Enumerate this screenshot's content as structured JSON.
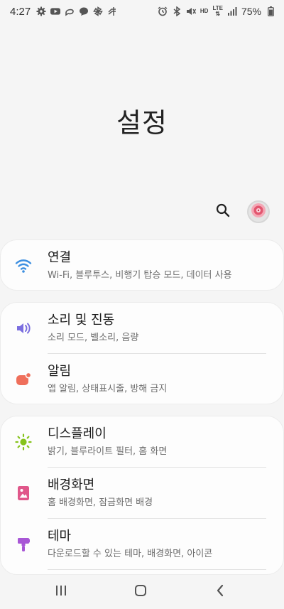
{
  "status_bar": {
    "time": "4:27",
    "battery": "75%",
    "hd": "HD",
    "lte": "LTE",
    "left_icons": [
      "settings-gear-icon",
      "youtube-icon",
      "messenger-icon",
      "chat-bubble-icon",
      "pinwheel-icon",
      "mute-bird-icon"
    ],
    "right_icons": [
      "alarm-icon",
      "bluetooth-icon",
      "mute-icon",
      "hd-lte-icon",
      "signal-icon",
      "battery-icon"
    ]
  },
  "header": {
    "title": "설정"
  },
  "groups": [
    {
      "items": [
        {
          "title": "연결",
          "subtitle": "Wi-Fi, 블루투스, 비행기 탑승 모드, 데이터 사용",
          "icon": "wifi-icon",
          "icon_color": "#3d8fe0"
        }
      ]
    },
    {
      "items": [
        {
          "title": "소리 및 진동",
          "subtitle": "소리 모드, 벨소리, 음량",
          "icon": "speaker-icon",
          "icon_color": "#7b6ee0"
        },
        {
          "title": "알림",
          "subtitle": "앱 알림, 상태표시줄, 방해 금지",
          "icon": "notification-icon",
          "icon_color": "#ef6f5b"
        }
      ]
    },
    {
      "items": [
        {
          "title": "디스플레이",
          "subtitle": "밝기, 블루라이트 필터, 홈 화면",
          "icon": "brightness-icon",
          "icon_color": "#86c31c"
        },
        {
          "title": "배경화면",
          "subtitle": "홈 배경화면, 잠금화면 배경",
          "icon": "wallpaper-icon",
          "icon_color": "#e0578a"
        },
        {
          "title": "테마",
          "subtitle": "다운로드할 수 있는 테마, 배경화면, 아이콘",
          "icon": "theme-brush-icon",
          "icon_color": "#a857d6"
        }
      ]
    }
  ],
  "colors": {
    "background": "#f5f5f5",
    "card": "#fdfdfd",
    "title_text": "#1c1c1c",
    "subtitle_text": "#6e6e6e"
  }
}
